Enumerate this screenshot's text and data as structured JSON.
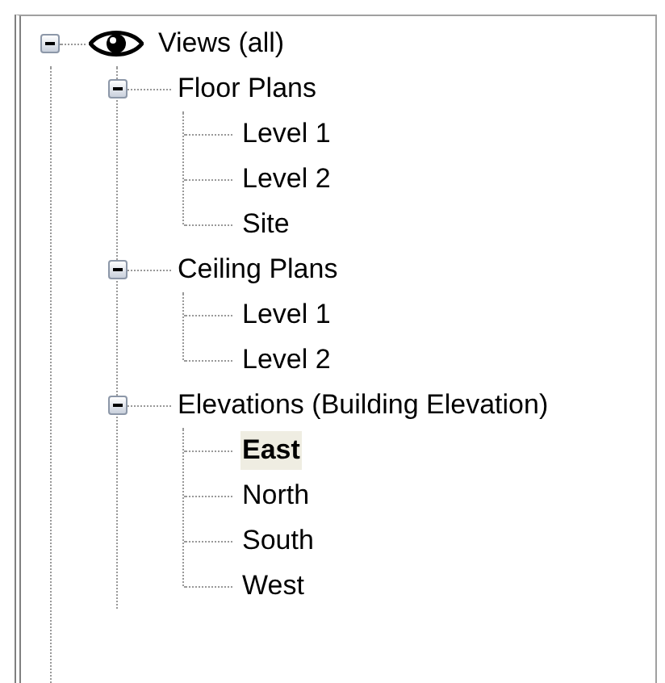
{
  "tree": {
    "label": "Views (all)",
    "expanded": true,
    "children": [
      {
        "label": "Floor Plans",
        "expanded": true,
        "children": [
          {
            "label": "Level 1",
            "selected": false
          },
          {
            "label": "Level 2",
            "selected": false
          },
          {
            "label": "Site",
            "selected": false
          }
        ]
      },
      {
        "label": "Ceiling Plans",
        "expanded": true,
        "children": [
          {
            "label": "Level 1",
            "selected": false
          },
          {
            "label": "Level 2",
            "selected": false
          }
        ]
      },
      {
        "label": "Elevations (Building Elevation)",
        "expanded": true,
        "children": [
          {
            "label": "East",
            "selected": true
          },
          {
            "label": "North",
            "selected": false
          },
          {
            "label": "South",
            "selected": false
          },
          {
            "label": "West",
            "selected": false
          }
        ]
      }
    ]
  }
}
